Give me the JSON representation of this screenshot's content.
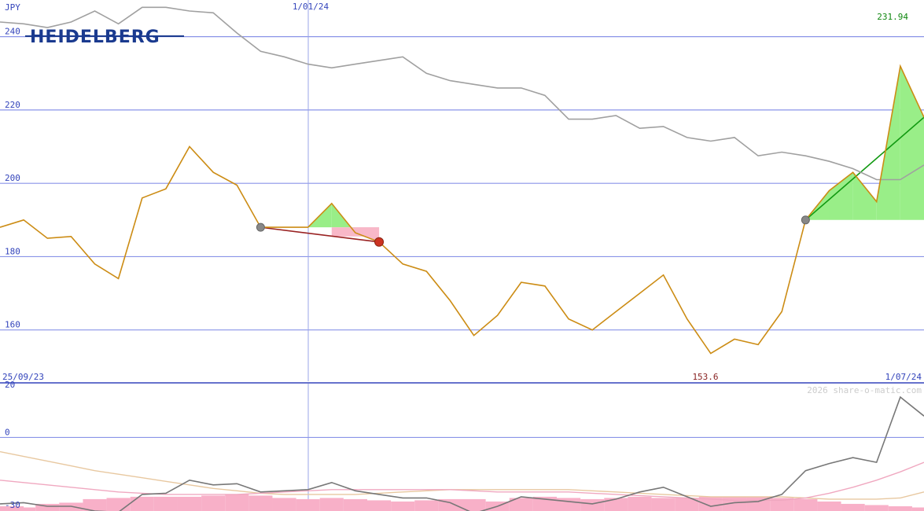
{
  "chart_data": [
    {
      "type": "line",
      "currency": "JPY",
      "brand": "HEIDELBERG",
      "date_label_top": "1/01/24",
      "start_date": "25/09/23",
      "end_date": "1/07/24",
      "max_label": "231.94",
      "min_label": "153.6",
      "watermark": "2026 share-o-matic.com",
      "ylim": [
        146,
        250
      ],
      "y_ticks": [
        {
          "value": 160,
          "label": "160"
        },
        {
          "value": 180,
          "label": "180"
        },
        {
          "value": 200,
          "label": "200"
        },
        {
          "value": 220,
          "label": "220"
        },
        {
          "value": 240,
          "label": "240"
        }
      ],
      "grid": true,
      "series": [
        {
          "role": "price",
          "color": "#cc8c14",
          "values": [
            188,
            190,
            185,
            185.5,
            178,
            174,
            196,
            198.5,
            210,
            203,
            199.5,
            188,
            188,
            188,
            194.5,
            186.5,
            184,
            178,
            176,
            168,
            158.5,
            164,
            173,
            172,
            163,
            160,
            165,
            170,
            175,
            163,
            153.6,
            157.5,
            156,
            165,
            190,
            198,
            203,
            195,
            231.94,
            218
          ]
        },
        {
          "role": "moving-average",
          "color": "#a0a0a0",
          "values": [
            244,
            243.5,
            242.5,
            244,
            247,
            243.5,
            248,
            248,
            247,
            246.5,
            241,
            236,
            234.5,
            232.5,
            231.5,
            232.5,
            233.5,
            234.5,
            230,
            228,
            227,
            226,
            226,
            224,
            217.5,
            217.5,
            218.5,
            215,
            215.5,
            212.5,
            211.5,
            212.5,
            207.5,
            208.5,
            207.5,
            206,
            204,
            201,
            201,
            205
          ]
        }
      ],
      "signals": [
        {
          "type": "sell",
          "from_index": 11,
          "to_index": 16,
          "from_value": 188,
          "to_value": 184,
          "color": "#992222"
        },
        {
          "type": "buy",
          "from_index": 34,
          "to_index": 39,
          "from_value": 190,
          "to_value": 218,
          "color": "#119911"
        }
      ]
    },
    {
      "type": "line",
      "ylim": [
        -31,
        22
      ],
      "y_ticks": [
        {
          "value": 20,
          "label": "20"
        },
        {
          "value": 0,
          "label": "0"
        },
        {
          "value": -30,
          "label": "-30"
        }
      ],
      "series": [
        {
          "role": "oscillator",
          "color": "#777777",
          "values": [
            -28,
            -27.5,
            -29,
            -29,
            -31,
            -31.5,
            -24,
            -23.5,
            -18,
            -20,
            -19.5,
            -23,
            -22.5,
            -22,
            -19,
            -22.5,
            -24,
            -25.5,
            -25.5,
            -27.5,
            -32,
            -29,
            -25,
            -26,
            -27,
            -28,
            -26,
            -23,
            -21,
            -25,
            -29,
            -27.5,
            -27,
            -24,
            -14,
            -11,
            -8.5,
            -10.5,
            17,
            9
          ]
        },
        {
          "role": "signal-line-1",
          "color": "#f0a8c0",
          "values": [
            -18,
            -19,
            -20,
            -21,
            -22,
            -23,
            -23.5,
            -24,
            -24,
            -24,
            -24,
            -23.5,
            -23,
            -22.5,
            -22,
            -22,
            -22,
            -22,
            -22,
            -22,
            -22.5,
            -23,
            -23,
            -23,
            -23,
            -23.5,
            -24,
            -24.5,
            -25,
            -25.5,
            -26,
            -26.5,
            -26.5,
            -26.5,
            -25.5,
            -23.5,
            -21,
            -18,
            -14.5,
            -10.5
          ]
        },
        {
          "role": "signal-line-2",
          "color": "#e8c8a0",
          "values": [
            -6,
            -8,
            -10,
            -12,
            -14,
            -15.5,
            -17,
            -18.5,
            -20,
            -21.5,
            -22.5,
            -23.5,
            -24,
            -24,
            -24,
            -24,
            -23.5,
            -23,
            -22.5,
            -22,
            -22,
            -22,
            -22,
            -22,
            -22,
            -22.5,
            -23,
            -23.5,
            -24,
            -24.5,
            -25,
            -25,
            -25,
            -25,
            -25.5,
            -26,
            -26,
            -26,
            -25.5,
            -23
          ]
        }
      ],
      "histogram": {
        "color": "#f8b0c8",
        "values": [
          -29,
          -29.5,
          -28,
          -27.5,
          -26,
          -25.5,
          -25,
          -25,
          -25,
          -24.5,
          -24,
          -24.5,
          -25.5,
          -26,
          -25.5,
          -26,
          -26.5,
          -27,
          -26.5,
          -26,
          -26,
          -27,
          -25.5,
          -25,
          -25.5,
          -26,
          -25.5,
          -25,
          -25.5,
          -25.5,
          -25,
          -25,
          -25,
          -25.5,
          -26,
          -27,
          -28,
          -28.5,
          -29,
          -29.5
        ]
      }
    }
  ]
}
